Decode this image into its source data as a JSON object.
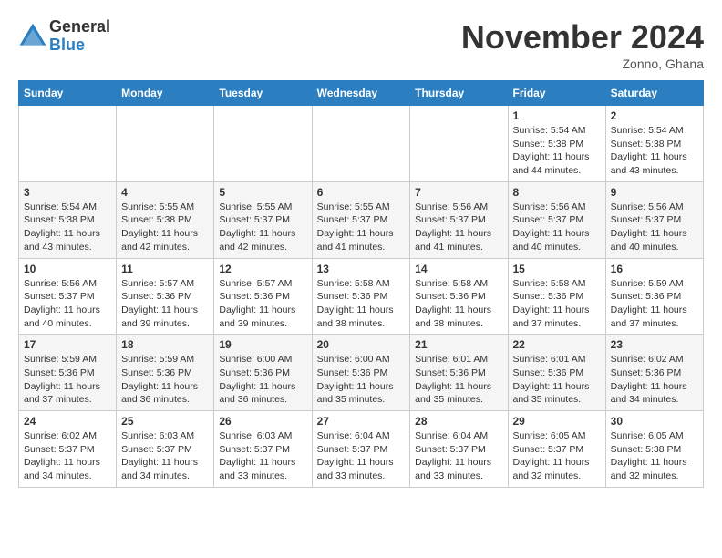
{
  "header": {
    "logo_line1": "General",
    "logo_line2": "Blue",
    "month": "November 2024",
    "location": "Zonno, Ghana"
  },
  "days_of_week": [
    "Sunday",
    "Monday",
    "Tuesday",
    "Wednesday",
    "Thursday",
    "Friday",
    "Saturday"
  ],
  "weeks": [
    [
      {
        "num": "",
        "info": ""
      },
      {
        "num": "",
        "info": ""
      },
      {
        "num": "",
        "info": ""
      },
      {
        "num": "",
        "info": ""
      },
      {
        "num": "",
        "info": ""
      },
      {
        "num": "1",
        "info": "Sunrise: 5:54 AM\nSunset: 5:38 PM\nDaylight: 11 hours\nand 44 minutes."
      },
      {
        "num": "2",
        "info": "Sunrise: 5:54 AM\nSunset: 5:38 PM\nDaylight: 11 hours\nand 43 minutes."
      }
    ],
    [
      {
        "num": "3",
        "info": "Sunrise: 5:54 AM\nSunset: 5:38 PM\nDaylight: 11 hours\nand 43 minutes."
      },
      {
        "num": "4",
        "info": "Sunrise: 5:55 AM\nSunset: 5:38 PM\nDaylight: 11 hours\nand 42 minutes."
      },
      {
        "num": "5",
        "info": "Sunrise: 5:55 AM\nSunset: 5:37 PM\nDaylight: 11 hours\nand 42 minutes."
      },
      {
        "num": "6",
        "info": "Sunrise: 5:55 AM\nSunset: 5:37 PM\nDaylight: 11 hours\nand 41 minutes."
      },
      {
        "num": "7",
        "info": "Sunrise: 5:56 AM\nSunset: 5:37 PM\nDaylight: 11 hours\nand 41 minutes."
      },
      {
        "num": "8",
        "info": "Sunrise: 5:56 AM\nSunset: 5:37 PM\nDaylight: 11 hours\nand 40 minutes."
      },
      {
        "num": "9",
        "info": "Sunrise: 5:56 AM\nSunset: 5:37 PM\nDaylight: 11 hours\nand 40 minutes."
      }
    ],
    [
      {
        "num": "10",
        "info": "Sunrise: 5:56 AM\nSunset: 5:37 PM\nDaylight: 11 hours\nand 40 minutes."
      },
      {
        "num": "11",
        "info": "Sunrise: 5:57 AM\nSunset: 5:36 PM\nDaylight: 11 hours\nand 39 minutes."
      },
      {
        "num": "12",
        "info": "Sunrise: 5:57 AM\nSunset: 5:36 PM\nDaylight: 11 hours\nand 39 minutes."
      },
      {
        "num": "13",
        "info": "Sunrise: 5:58 AM\nSunset: 5:36 PM\nDaylight: 11 hours\nand 38 minutes."
      },
      {
        "num": "14",
        "info": "Sunrise: 5:58 AM\nSunset: 5:36 PM\nDaylight: 11 hours\nand 38 minutes."
      },
      {
        "num": "15",
        "info": "Sunrise: 5:58 AM\nSunset: 5:36 PM\nDaylight: 11 hours\nand 37 minutes."
      },
      {
        "num": "16",
        "info": "Sunrise: 5:59 AM\nSunset: 5:36 PM\nDaylight: 11 hours\nand 37 minutes."
      }
    ],
    [
      {
        "num": "17",
        "info": "Sunrise: 5:59 AM\nSunset: 5:36 PM\nDaylight: 11 hours\nand 37 minutes."
      },
      {
        "num": "18",
        "info": "Sunrise: 5:59 AM\nSunset: 5:36 PM\nDaylight: 11 hours\nand 36 minutes."
      },
      {
        "num": "19",
        "info": "Sunrise: 6:00 AM\nSunset: 5:36 PM\nDaylight: 11 hours\nand 36 minutes."
      },
      {
        "num": "20",
        "info": "Sunrise: 6:00 AM\nSunset: 5:36 PM\nDaylight: 11 hours\nand 35 minutes."
      },
      {
        "num": "21",
        "info": "Sunrise: 6:01 AM\nSunset: 5:36 PM\nDaylight: 11 hours\nand 35 minutes."
      },
      {
        "num": "22",
        "info": "Sunrise: 6:01 AM\nSunset: 5:36 PM\nDaylight: 11 hours\nand 35 minutes."
      },
      {
        "num": "23",
        "info": "Sunrise: 6:02 AM\nSunset: 5:36 PM\nDaylight: 11 hours\nand 34 minutes."
      }
    ],
    [
      {
        "num": "24",
        "info": "Sunrise: 6:02 AM\nSunset: 5:37 PM\nDaylight: 11 hours\nand 34 minutes."
      },
      {
        "num": "25",
        "info": "Sunrise: 6:03 AM\nSunset: 5:37 PM\nDaylight: 11 hours\nand 34 minutes."
      },
      {
        "num": "26",
        "info": "Sunrise: 6:03 AM\nSunset: 5:37 PM\nDaylight: 11 hours\nand 33 minutes."
      },
      {
        "num": "27",
        "info": "Sunrise: 6:04 AM\nSunset: 5:37 PM\nDaylight: 11 hours\nand 33 minutes."
      },
      {
        "num": "28",
        "info": "Sunrise: 6:04 AM\nSunset: 5:37 PM\nDaylight: 11 hours\nand 33 minutes."
      },
      {
        "num": "29",
        "info": "Sunrise: 6:05 AM\nSunset: 5:37 PM\nDaylight: 11 hours\nand 32 minutes."
      },
      {
        "num": "30",
        "info": "Sunrise: 6:05 AM\nSunset: 5:38 PM\nDaylight: 11 hours\nand 32 minutes."
      }
    ]
  ]
}
